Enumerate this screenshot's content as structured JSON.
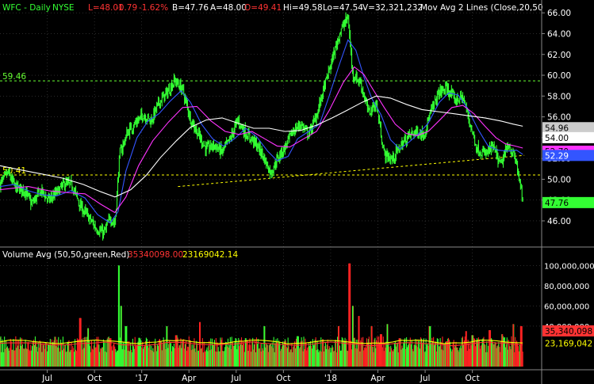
{
  "header": {
    "ticker": "WFC - Daily",
    "exchange": "NYSE",
    "last": "L=48.01",
    "change": "-0.79",
    "change_pct": "-1.62%",
    "bid": "B=47.76",
    "ask": "A=48.00",
    "open": "O=49.41",
    "high": "Hi=49.58",
    "low": "Lo=47.54",
    "volume": "V=32,321,232",
    "study": "Mov Avg 2 Lines (Close,20,50"
  },
  "volume_header": {
    "label": "Volume Avg (50,50,green,Red)",
    "avg1": "35340098.00",
    "avg2": "23169042.14"
  },
  "colors": {
    "background": "#000000",
    "up_bar": "#33ff33",
    "down_bar": "#ff2222",
    "ma_20": "#3355ff",
    "ma_50": "#ff33ff",
    "ma_200": "#ffffff",
    "resistance": "#66ff33",
    "trendline": "#ffff00",
    "support": "#ffff00",
    "vol_avg1": "#ff3333",
    "vol_avg2": "#ffff00",
    "grid": "#444444",
    "axis_text": "#ffffff"
  },
  "chart_data": [
    {
      "type": "candlestick",
      "title": "WFC - Daily",
      "y_axis_ticks": [
        "66.00",
        "64.00",
        "62.00",
        "60.00",
        "58.00",
        "56.00",
        "54.00",
        "52.00",
        "50.00",
        "48.00",
        "46.00"
      ],
      "ylim": [
        44.4,
        66.7
      ],
      "x_axis_ticks": [
        "Jul",
        "Oct",
        "'17",
        "Apr",
        "Jul",
        "Oct",
        "'18",
        "Apr",
        "Jul",
        "Oct"
      ],
      "x_tick_months": [
        3,
        6,
        9,
        12,
        15,
        18,
        21,
        24,
        27,
        30
      ],
      "xlim_months": [
        0.0,
        34.4
      ],
      "close_path": [
        [
          0.0,
          49.5
        ],
        [
          0.5,
          50.6
        ],
        [
          1.0,
          49.2
        ],
        [
          1.6,
          48.9
        ],
        [
          2.0,
          47.6
        ],
        [
          2.6,
          48.9
        ],
        [
          3.1,
          48.0
        ],
        [
          3.6,
          48.7
        ],
        [
          4.1,
          49.6
        ],
        [
          4.6,
          49.4
        ],
        [
          5.1,
          47.4
        ],
        [
          5.6,
          46.4
        ],
        [
          6.1,
          45.3
        ],
        [
          6.6,
          44.8
        ],
        [
          7.0,
          46.3
        ],
        [
          7.3,
          45.7
        ],
        [
          7.6,
          52.4
        ],
        [
          8.1,
          54.5
        ],
        [
          8.6,
          55.4
        ],
        [
          9.1,
          56.2
        ],
        [
          9.6,
          55.6
        ],
        [
          10.1,
          57.4
        ],
        [
          10.6,
          58.3
        ],
        [
          11.1,
          59.5
        ],
        [
          11.6,
          58.6
        ],
        [
          12.1,
          55.8
        ],
        [
          12.6,
          54.3
        ],
        [
          13.1,
          52.9
        ],
        [
          13.6,
          53.3
        ],
        [
          14.1,
          52.6
        ],
        [
          14.6,
          53.8
        ],
        [
          15.1,
          55.7
        ],
        [
          15.6,
          54.4
        ],
        [
          16.1,
          53.7
        ],
        [
          16.6,
          52.6
        ],
        [
          17.2,
          50.6
        ],
        [
          17.6,
          51.9
        ],
        [
          18.1,
          53.1
        ],
        [
          18.6,
          54.6
        ],
        [
          19.1,
          55.3
        ],
        [
          19.6,
          54.3
        ],
        [
          20.1,
          56.1
        ],
        [
          20.6,
          58.9
        ],
        [
          21.1,
          61.5
        ],
        [
          21.6,
          64.2
        ],
        [
          22.1,
          65.6
        ],
        [
          22.4,
          60.1
        ],
        [
          22.9,
          59.3
        ],
        [
          23.4,
          56.4
        ],
        [
          23.9,
          57.3
        ],
        [
          24.4,
          52.4
        ],
        [
          24.9,
          51.9
        ],
        [
          25.4,
          53.1
        ],
        [
          25.9,
          54.1
        ],
        [
          26.4,
          54.6
        ],
        [
          26.9,
          54.3
        ],
        [
          27.4,
          56.6
        ],
        [
          27.9,
          58.4
        ],
        [
          28.4,
          58.7
        ],
        [
          28.9,
          57.6
        ],
        [
          29.4,
          57.9
        ],
        [
          29.9,
          55.1
        ],
        [
          30.3,
          52.9
        ],
        [
          30.8,
          52.4
        ],
        [
          31.3,
          53.1
        ],
        [
          31.8,
          51.3
        ],
        [
          32.3,
          53.4
        ],
        [
          32.8,
          51.6
        ],
        [
          33.2,
          47.8
        ]
      ],
      "overlays": [
        {
          "name": "MA 20",
          "color": "#3355ff",
          "points": [
            [
              0.0,
              49.3
            ],
            [
              0.9,
              49.5
            ],
            [
              1.8,
              48.9
            ],
            [
              2.7,
              48.5
            ],
            [
              3.6,
              48.4
            ],
            [
              4.5,
              48.9
            ],
            [
              5.4,
              48.2
            ],
            [
              6.2,
              46.6
            ],
            [
              7.0,
              45.8
            ],
            [
              7.5,
              46.9
            ],
            [
              8.0,
              50.8
            ],
            [
              8.7,
              54.0
            ],
            [
              9.4,
              55.6
            ],
            [
              10.1,
              56.3
            ],
            [
              10.8,
              57.5
            ],
            [
              11.5,
              58.5
            ],
            [
              12.1,
              57.4
            ],
            [
              12.8,
              55.3
            ],
            [
              13.5,
              53.9
            ],
            [
              14.2,
              53.2
            ],
            [
              14.9,
              53.9
            ],
            [
              15.6,
              54.9
            ],
            [
              16.3,
              54.1
            ],
            [
              17.0,
              52.7
            ],
            [
              17.6,
              51.8
            ],
            [
              18.3,
              52.2
            ],
            [
              18.9,
              53.9
            ],
            [
              19.6,
              54.6
            ],
            [
              20.3,
              55.3
            ],
            [
              20.9,
              58.0
            ],
            [
              21.5,
              60.8
            ],
            [
              22.1,
              63.4
            ],
            [
              22.6,
              62.4
            ],
            [
              23.1,
              59.9
            ],
            [
              23.6,
              57.8
            ],
            [
              24.2,
              56.2
            ],
            [
              24.8,
              53.8
            ],
            [
              25.4,
              52.9
            ],
            [
              26.0,
              53.6
            ],
            [
              26.6,
              54.4
            ],
            [
              27.2,
              55.4
            ],
            [
              27.9,
              57.4
            ],
            [
              28.5,
              58.3
            ],
            [
              29.1,
              58.1
            ],
            [
              29.7,
              56.8
            ],
            [
              30.4,
              54.7
            ],
            [
              31.0,
              53.2
            ],
            [
              31.6,
              52.8
            ],
            [
              32.3,
              52.7
            ],
            [
              32.8,
              52.8
            ],
            [
              33.2,
              52.4
            ]
          ]
        },
        {
          "name": "MA 50",
          "color": "#ff33ff",
          "points": [
            [
              0.0,
              49.0
            ],
            [
              1.8,
              49.3
            ],
            [
              3.1,
              48.9
            ],
            [
              4.4,
              48.7
            ],
            [
              5.4,
              48.6
            ],
            [
              6.4,
              47.6
            ],
            [
              7.3,
              46.8
            ],
            [
              8.0,
              48.3
            ],
            [
              8.8,
              51.3
            ],
            [
              9.7,
              53.7
            ],
            [
              10.7,
              55.5
            ],
            [
              11.6,
              56.9
            ],
            [
              12.5,
              57.0
            ],
            [
              13.4,
              55.6
            ],
            [
              14.3,
              54.6
            ],
            [
              15.2,
              54.3
            ],
            [
              16.0,
              54.6
            ],
            [
              16.8,
              53.9
            ],
            [
              17.6,
              53.2
            ],
            [
              18.4,
              53.1
            ],
            [
              19.3,
              53.9
            ],
            [
              20.1,
              54.6
            ],
            [
              20.9,
              56.6
            ],
            [
              21.8,
              59.3
            ],
            [
              22.5,
              60.8
            ],
            [
              23.1,
              60.1
            ],
            [
              23.7,
              58.6
            ],
            [
              24.4,
              56.9
            ],
            [
              25.1,
              55.3
            ],
            [
              25.8,
              54.4
            ],
            [
              26.5,
              54.2
            ],
            [
              27.2,
              54.6
            ],
            [
              28.0,
              55.8
            ],
            [
              28.7,
              56.9
            ],
            [
              29.4,
              57.1
            ],
            [
              30.1,
              56.3
            ],
            [
              30.8,
              55.1
            ],
            [
              31.5,
              54.0
            ],
            [
              32.1,
              53.4
            ],
            [
              32.7,
              53.2
            ],
            [
              33.2,
              53.0
            ]
          ]
        },
        {
          "name": "MA 200",
          "color": "#ffffff",
          "points": [
            [
              0.0,
              51.3
            ],
            [
              1.3,
              50.9
            ],
            [
              2.7,
              50.5
            ],
            [
              4.0,
              50.1
            ],
            [
              5.3,
              49.5
            ],
            [
              6.4,
              48.8
            ],
            [
              7.3,
              48.3
            ],
            [
              8.3,
              49.0
            ],
            [
              9.3,
              50.4
            ],
            [
              10.2,
              52.1
            ],
            [
              11.2,
              53.7
            ],
            [
              12.1,
              55.0
            ],
            [
              13.1,
              55.7
            ],
            [
              14.1,
              55.9
            ],
            [
              15.1,
              55.4
            ],
            [
              16.1,
              54.9
            ],
            [
              17.1,
              54.9
            ],
            [
              18.1,
              54.6
            ],
            [
              19.1,
              54.7
            ],
            [
              20.1,
              55.2
            ],
            [
              21.1,
              55.9
            ],
            [
              22.0,
              56.6
            ],
            [
              23.0,
              57.4
            ],
            [
              23.9,
              58.0
            ],
            [
              24.8,
              57.8
            ],
            [
              25.8,
              57.2
            ],
            [
              26.8,
              56.7
            ],
            [
              27.8,
              56.5
            ],
            [
              28.8,
              56.3
            ],
            [
              29.8,
              56.1
            ],
            [
              30.8,
              55.9
            ],
            [
              31.8,
              55.6
            ],
            [
              32.6,
              55.3
            ],
            [
              33.2,
              55.1
            ]
          ]
        }
      ],
      "horizontal_lines": [
        {
          "label": "59.46",
          "value": 59.46,
          "color": "#66ff33",
          "style": "dashed"
        },
        {
          "label": "50.41",
          "value": 50.41,
          "color": "#ffff00",
          "style": "dashed"
        }
      ],
      "trendlines": [
        {
          "from": [
            11.3,
            49.3
          ],
          "to": [
            33.3,
            52.3
          ],
          "color": "#ffff00",
          "style": "dashed"
        }
      ],
      "price_labels": [
        {
          "text": "54.96",
          "value": 54.96,
          "bg": "#cccccc",
          "fg": "#000000"
        },
        {
          "text": "54.00",
          "value": 54.0,
          "bg": "#ffffff",
          "fg": "#000000"
        },
        {
          "text": "52.70",
          "value": 52.7,
          "bg": "#ff33ff",
          "fg": "#000000"
        },
        {
          "text": "52.29",
          "value": 52.29,
          "bg": "#3355ff",
          "fg": "#ffffff"
        },
        {
          "text": "47.76",
          "value": 47.76,
          "bg": "#33ff33",
          "fg": "#000000"
        }
      ]
    },
    {
      "type": "bar",
      "title": "Volume Avg (50,50,green,Red)",
      "y_axis_ticks": [
        "100,000,000",
        "80,000,000",
        "60,000,000",
        "40,000,000"
      ],
      "ylim": [
        0,
        112000000
      ],
      "spikes": [
        [
          0.5,
          18000000,
          "up"
        ],
        [
          2.3,
          14000000,
          "down"
        ],
        [
          3.1,
          22000000,
          "up"
        ],
        [
          5.1,
          48000000,
          "down"
        ],
        [
          5.6,
          38000000,
          "up"
        ],
        [
          7.0,
          28000000,
          "down"
        ],
        [
          7.55,
          100000000,
          "up"
        ],
        [
          7.7,
          60000000,
          "up"
        ],
        [
          8.0,
          40000000,
          "up"
        ],
        [
          10.6,
          40000000,
          "up"
        ],
        [
          11.2,
          31000000,
          "down"
        ],
        [
          12.7,
          44000000,
          "down"
        ],
        [
          15.6,
          28000000,
          "up"
        ],
        [
          16.8,
          40000000,
          "up"
        ],
        [
          17.6,
          24000000,
          "down"
        ],
        [
          18.9,
          30000000,
          "up"
        ],
        [
          20.5,
          27000000,
          "down"
        ],
        [
          21.5,
          40000000,
          "down"
        ],
        [
          22.2,
          102000000,
          "down"
        ],
        [
          22.4,
          60000000,
          "up"
        ],
        [
          22.8,
          50000000,
          "down"
        ],
        [
          23.6,
          40000000,
          "down"
        ],
        [
          24.2,
          32000000,
          "down"
        ],
        [
          24.6,
          42000000,
          "up"
        ],
        [
          25.4,
          28000000,
          "down"
        ],
        [
          27.3,
          40000000,
          "up"
        ],
        [
          28.4,
          25000000,
          "down"
        ],
        [
          29.6,
          35000000,
          "down"
        ],
        [
          30.0,
          31000000,
          "up"
        ],
        [
          30.4,
          26000000,
          "down"
        ],
        [
          31.1,
          36000000,
          "down"
        ],
        [
          31.9,
          32000000,
          "down"
        ],
        [
          32.6,
          42000000,
          "down"
        ],
        [
          33.1,
          40000000,
          "down"
        ]
      ],
      "series": [
        {
          "name": "35,340,098",
          "value": 35340098,
          "color": "#ff3333"
        },
        {
          "name": "23,169,042",
          "value": 23169042,
          "color": "#ffff00"
        }
      ]
    }
  ]
}
